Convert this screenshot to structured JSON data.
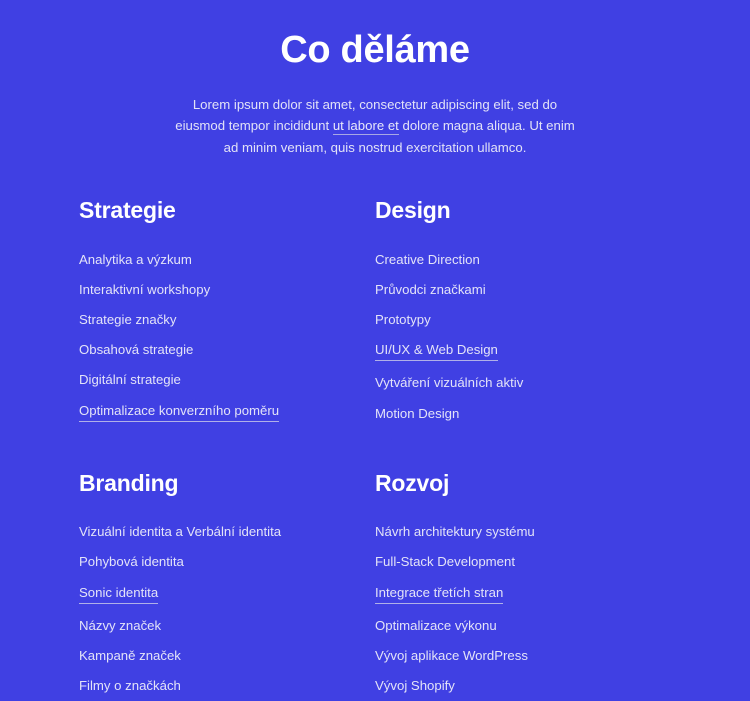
{
  "theme": {
    "background": "#4040e3",
    "title_color": "#ffffff",
    "body_text_color": "#e3e3f8",
    "underline_color": "#b0b0e8"
  },
  "header": {
    "title": "Co děláme",
    "intro_before_link": "Lorem ipsum dolor sit amet, consectetur adipiscing elit, sed do eiusmod tempor incididunt ",
    "intro_link": "ut labore et",
    "intro_after_link": " dolore magna aliqua. Ut enim ad minim veniam, quis nostrud exercitation ullamco."
  },
  "columns": [
    {
      "title": "Strategie",
      "items": [
        {
          "label": "Analytika a výzkum",
          "underlined": false
        },
        {
          "label": "Interaktivní workshopy",
          "underlined": false
        },
        {
          "label": "Strategie značky",
          "underlined": false
        },
        {
          "label": "Obsahová strategie",
          "underlined": false
        },
        {
          "label": "Digitální strategie",
          "underlined": false
        },
        {
          "label": "Optimalizace konverzního poměru",
          "underlined": true
        }
      ]
    },
    {
      "title": "Design",
      "items": [
        {
          "label": "Creative Direction",
          "underlined": false
        },
        {
          "label": "Průvodci značkami",
          "underlined": false
        },
        {
          "label": "Prototypy",
          "underlined": false
        },
        {
          "label": "UI/UX & Web Design",
          "underlined": true
        },
        {
          "label": "Vytváření vizuálních aktiv",
          "underlined": false
        },
        {
          "label": "Motion Design",
          "underlined": false
        }
      ]
    },
    {
      "title": "Branding",
      "items": [
        {
          "label": "Vizuální identita a Verbální identita",
          "underlined": false
        },
        {
          "label": "Pohybová identita",
          "underlined": false
        },
        {
          "label": "Sonic identita",
          "underlined": true
        },
        {
          "label": "Názvy značek",
          "underlined": false
        },
        {
          "label": "Kampaně značek",
          "underlined": false
        },
        {
          "label": "Filmy o značkách",
          "underlined": false
        }
      ]
    },
    {
      "title": "Rozvoj",
      "items": [
        {
          "label": "Návrh architektury systému",
          "underlined": false
        },
        {
          "label": "Full-Stack Development",
          "underlined": false
        },
        {
          "label": "Integrace třetích stran",
          "underlined": true
        },
        {
          "label": "Optimalizace výkonu",
          "underlined": false
        },
        {
          "label": "Vývoj aplikace WordPress",
          "underlined": false
        },
        {
          "label": "Vývoj Shopify",
          "underlined": false
        }
      ]
    }
  ]
}
